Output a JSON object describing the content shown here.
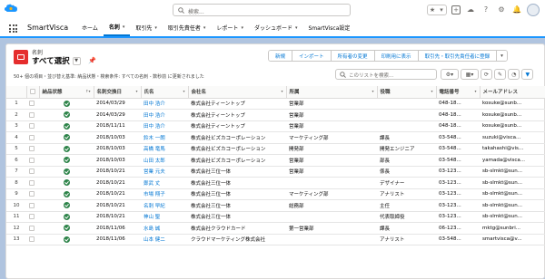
{
  "app": {
    "name": "SmartVisca",
    "search_placeholder": "検索..."
  },
  "nav": [
    {
      "label": "ホーム",
      "chevron": false,
      "active": false
    },
    {
      "label": "名刺",
      "chevron": true,
      "active": true
    },
    {
      "label": "取引先",
      "chevron": true,
      "active": false
    },
    {
      "label": "取引先責任者",
      "chevron": true,
      "active": false
    },
    {
      "label": "レポート",
      "chevron": true,
      "active": false
    },
    {
      "label": "ダッシュボード",
      "chevron": true,
      "active": false
    },
    {
      "label": "SmartVisca設定",
      "chevron": false,
      "active": false
    }
  ],
  "list": {
    "object_label": "名刺",
    "view_name": "すべて選択",
    "meta": "50+ 個の項目・並び替え基準: 納品状態・検索条件: すべての名刺 - 数秒前 に更新されました",
    "buttons": [
      "新規",
      "インポート",
      "所有者の変更",
      "印刷用に表示",
      "取引先・取引先責任者に登録"
    ],
    "search_placeholder": "このリストを検索..."
  },
  "columns": [
    "納品状態",
    "名刺交換日",
    "氏名",
    "会社名",
    "所属",
    "役職",
    "電話番号",
    "メールアドレス"
  ],
  "rows": [
    {
      "n": "1",
      "date": "2014/03/29",
      "name": "田中 浩介",
      "company": "株式会社ティーントップ",
      "dept": "営業部",
      "title": "",
      "phone": "048-18...",
      "email": "kosuke@sunb..."
    },
    {
      "n": "2",
      "date": "2014/03/29",
      "name": "田中 浩介",
      "company": "株式会社ティーントップ",
      "dept": "営業部",
      "title": "",
      "phone": "048-18...",
      "email": "kosuke@sunb..."
    },
    {
      "n": "3",
      "date": "2018/11/11",
      "name": "田中 浩介",
      "company": "株式会社ティーントップ",
      "dept": "営業部",
      "title": "",
      "phone": "048-18...",
      "email": "kosuke@sunb..."
    },
    {
      "n": "4",
      "date": "2018/10/03",
      "name": "鈴木 一朗",
      "company": "株式会社ビズカコーポレーション",
      "dept": "マーケティング部",
      "title": "課長",
      "phone": "03-548...",
      "email": "suzuki@visca..."
    },
    {
      "n": "5",
      "date": "2018/10/03",
      "name": "高橋 竜馬",
      "company": "株式会社ビズカコーポレーション",
      "dept": "開発部",
      "title": "開発エンジニア",
      "phone": "03-548...",
      "email": "takahashi@vis..."
    },
    {
      "n": "6",
      "date": "2018/10/03",
      "name": "山田 太郎",
      "company": "株式会社ビズカコーポレーション",
      "dept": "営業部",
      "title": "部長",
      "phone": "03-548...",
      "email": "yamada@visca..."
    },
    {
      "n": "7",
      "date": "2018/10/21",
      "name": "営業 元夫",
      "company": "株式会社三位一体",
      "dept": "営業部",
      "title": "係長",
      "phone": "03-123...",
      "email": "sb-slmkt@sun..."
    },
    {
      "n": "8",
      "date": "2018/10/21",
      "name": "鄭武 丈",
      "company": "株式会社三位一体",
      "dept": "",
      "title": "デザイナー",
      "phone": "03-123...",
      "email": "sb-slmkt@sun..."
    },
    {
      "n": "9",
      "date": "2018/10/21",
      "name": "市場 翔子",
      "company": "株式会社三位一体",
      "dept": "マーケティング部",
      "title": "アナリスト",
      "phone": "03-123...",
      "email": "sb-slmkt@sun..."
    },
    {
      "n": "10",
      "date": "2018/10/21",
      "name": "名刺 早紀",
      "company": "株式会社三位一体",
      "dept": "総務部",
      "title": "主任",
      "phone": "03-123...",
      "email": "sb-slmkt@sun..."
    },
    {
      "n": "11",
      "date": "2018/10/21",
      "name": "神山 聖",
      "company": "株式会社三位一体",
      "dept": "",
      "title": "代表取締役",
      "phone": "03-123...",
      "email": "sb-slmkt@sun..."
    },
    {
      "n": "12",
      "date": "2018/11/06",
      "name": "水島 誠",
      "company": "株式会社クラウドカード",
      "dept": "第一営業部",
      "title": "課長",
      "phone": "06-123...",
      "email": "mktg@sunbri..."
    },
    {
      "n": "13",
      "date": "2018/11/06",
      "name": "山本 健二",
      "company": "クラウドマーケティング株式会社",
      "dept": "",
      "title": "アナリスト",
      "phone": "03-548...",
      "email": "smartvisca@v..."
    }
  ],
  "colors": {
    "accent": "#0176d3",
    "brand_bg": "#b0c4df",
    "object_icon": "#e52d2d",
    "status_ok": "#2e844a"
  }
}
